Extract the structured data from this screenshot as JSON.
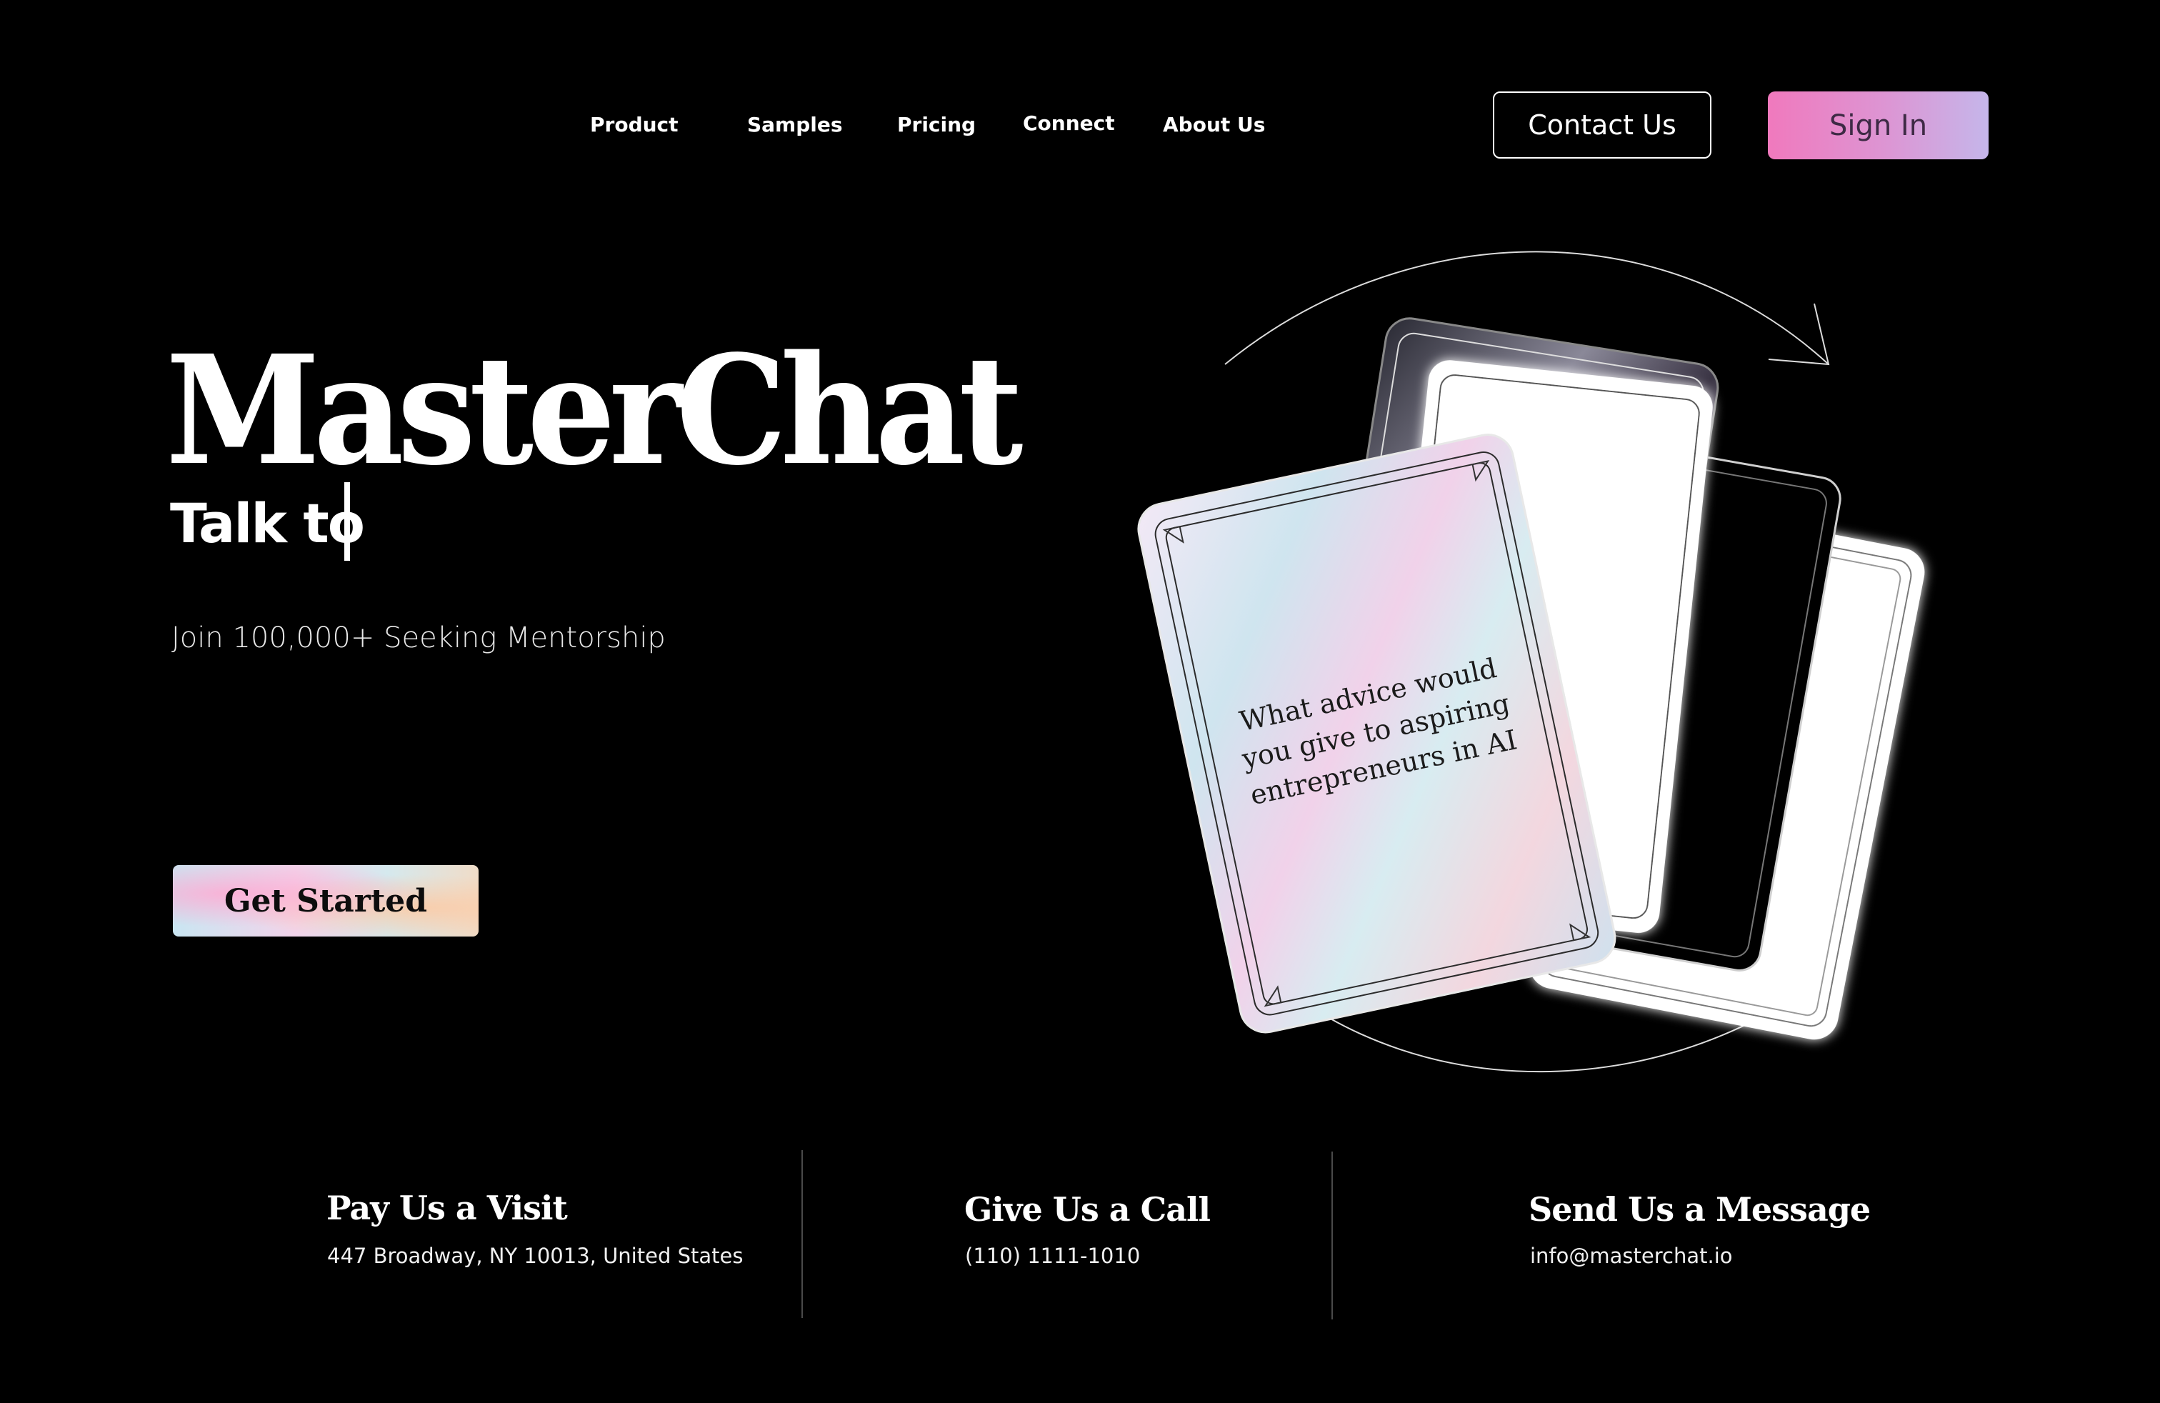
{
  "nav": {
    "links": [
      "Product",
      "Samples",
      "Pricing",
      "Connect",
      "About Us"
    ],
    "contact_button": "Contact Us",
    "signin_button": "Sign In"
  },
  "hero": {
    "brand": "MasterChat",
    "talk_to": "Talk to",
    "tagline": "Join 100,000+ Seeking Mentorship",
    "cta": "Get Started",
    "card_question": [
      "What advice would",
      "you give to aspiring",
      "entrepreneurs in AI"
    ]
  },
  "contact": {
    "visit": {
      "title": "Pay Us a Visit",
      "text": "447 Broadway, NY 10013, United States"
    },
    "call": {
      "title": "Give Us a Call",
      "text": "(110) 1111-1010"
    },
    "message": {
      "title": "Send Us a Message",
      "text": "info@masterchat.io"
    }
  },
  "colors": {
    "background": "#000000",
    "signin_gradient": [
      "#f079bd",
      "#c5b6ea"
    ]
  }
}
